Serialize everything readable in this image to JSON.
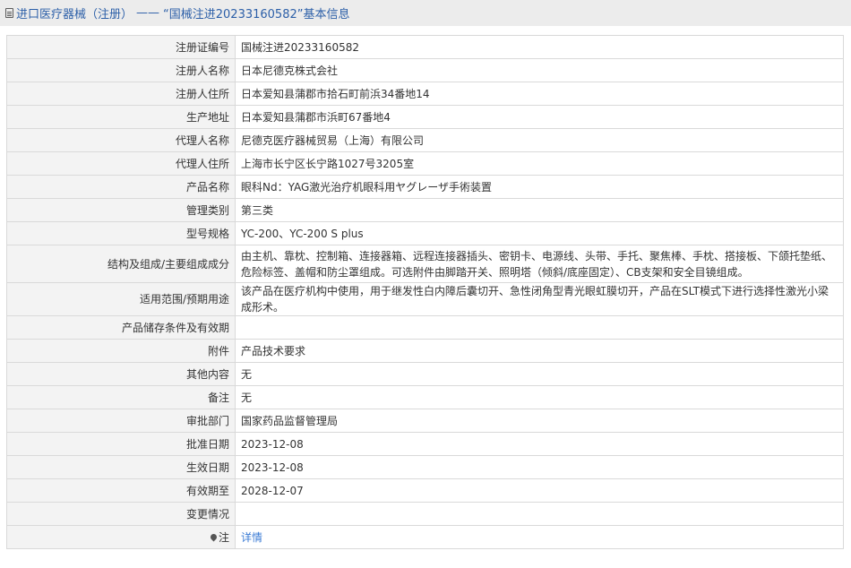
{
  "header": {
    "title": "进口医疗器械（注册）",
    "separator": "——",
    "subtitle": "“国械注进20233160582”基本信息"
  },
  "rows": [
    {
      "label": "注册证编号",
      "value": "国械注进20233160582"
    },
    {
      "label": "注册人名称",
      "value": "日本尼德克株式会社"
    },
    {
      "label": "注册人住所",
      "value": "日本爱知县蒲郡市拾石町前浜34番地14"
    },
    {
      "label": "生产地址",
      "value": "日本爱知县蒲郡市浜町67番地4"
    },
    {
      "label": "代理人名称",
      "value": "尼德克医疗器械贸易（上海）有限公司"
    },
    {
      "label": "代理人住所",
      "value": "上海市长宁区长宁路1027号3205室"
    },
    {
      "label": "产品名称",
      "value": "眼科Nd：YAG激光治疗机眼科用ヤグレーザ手術装置"
    },
    {
      "label": "管理类别",
      "value": "第三类"
    },
    {
      "label": "型号规格",
      "value": "YC-200、YC-200 S plus"
    },
    {
      "label": "结构及组成/主要组成成分",
      "value": "由主机、靠枕、控制箱、连接器箱、远程连接器插头、密钥卡、电源线、头带、手托、聚焦棒、手枕、搭接板、下颌托垫纸、危险标签、盖帽和防尘罩组成。可选附件由脚踏开关、照明塔（倾斜/底座固定）、CB支架和安全目镜组成。"
    },
    {
      "label": "适用范围/预期用途",
      "value": "该产品在医疗机构中使用，用于继发性白内障后囊切开、急性闭角型青光眼虹膜切开，产品在SLT模式下进行选择性激光小梁成形术。"
    },
    {
      "label": "产品储存条件及有效期",
      "value": ""
    },
    {
      "label": "附件",
      "value": "产品技术要求"
    },
    {
      "label": "其他内容",
      "value": "无"
    },
    {
      "label": "备注",
      "value": "无"
    },
    {
      "label": "审批部门",
      "value": "国家药品监督管理局"
    },
    {
      "label": "批准日期",
      "value": "2023-12-08"
    },
    {
      "label": "生效日期",
      "value": "2023-12-08"
    },
    {
      "label": "有效期至",
      "value": "2028-12-07"
    },
    {
      "label": "变更情况",
      "value": ""
    },
    {
      "label": "注",
      "value": "详情"
    }
  ]
}
